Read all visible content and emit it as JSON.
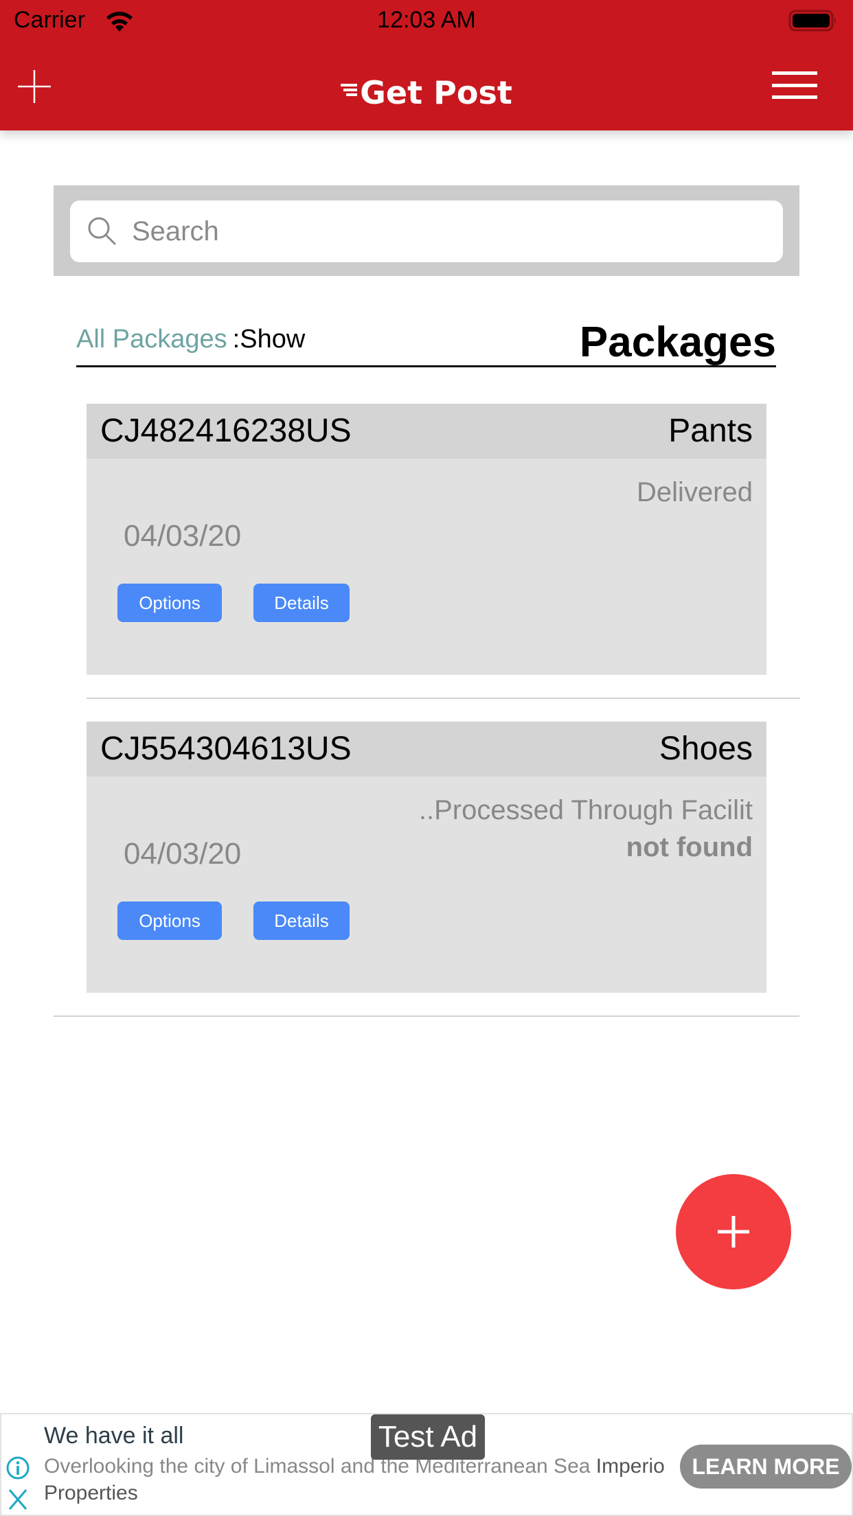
{
  "status_bar": {
    "carrier": "Carrier",
    "time": "12:03 AM",
    "battery_level": 1.0
  },
  "header": {
    "logo_text": "Get Post",
    "left_icon": "plus-icon",
    "right_icon": "hamburger-menu-icon",
    "background_color": "#c8171e"
  },
  "search": {
    "placeholder": "Search",
    "value": ""
  },
  "filter": {
    "selected_label": "All Packages",
    "show_label": ":Show"
  },
  "page_title": "Packages",
  "packages": [
    {
      "tracking_number": "CJ482416238US",
      "name": "Pants",
      "status": "Delivered",
      "status_detail": "",
      "date": "04/03/20",
      "options_label": "Options",
      "details_label": "Details"
    },
    {
      "tracking_number": "CJ554304613US",
      "name": "Shoes",
      "status": "..Processed Through Facilit",
      "status_detail": "not found",
      "date": "04/03/20",
      "options_label": "Options",
      "details_label": "Details"
    }
  ],
  "fab": {
    "icon": "plus-icon",
    "color": "#f33d40"
  },
  "ad": {
    "badge": "Test Ad",
    "title": "We have it all",
    "body": "Overlooking the city of Limassol and the Mediterranean Sea",
    "advertiser": "Imperio Properties",
    "cta_label": "LEARN MORE"
  },
  "colors": {
    "accent_button": "#4a89f7",
    "filter_link": "#6fa3a3"
  }
}
